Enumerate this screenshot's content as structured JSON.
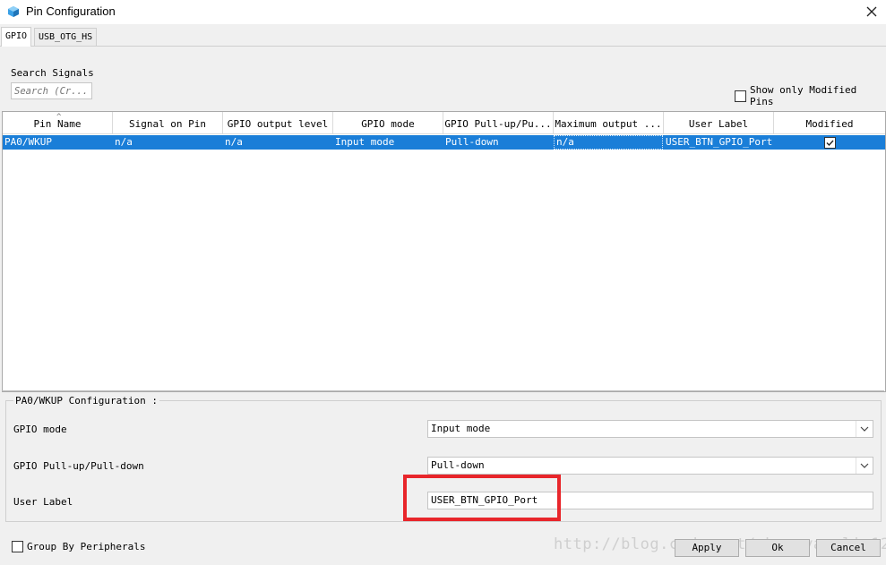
{
  "window": {
    "title": "Pin Configuration",
    "icon": "cube-icon",
    "close_icon": "close-icon"
  },
  "tabs": [
    {
      "label": "GPIO",
      "active": true
    },
    {
      "label": "USB_OTG_HS",
      "active": false
    }
  ],
  "search": {
    "label": "Search Signals",
    "placeholder": "Search (Cr..."
  },
  "show_modified": {
    "label": "Show only Modified Pins",
    "checked": false
  },
  "table": {
    "headers": [
      "Pin Name",
      "Signal on Pin",
      "GPIO output level",
      "GPIO mode",
      "GPIO Pull-up/Pu...",
      "Maximum output ...",
      "User Label",
      "Modified"
    ],
    "rows": [
      {
        "pin_name": "PA0/WKUP",
        "signal_on_pin": "n/a",
        "gpio_output_level": "n/a",
        "gpio_mode": "Input mode",
        "gpio_pull": "Pull-down",
        "max_output": "n/a",
        "user_label": "USER_BTN_GPIO_Port",
        "modified": true
      }
    ]
  },
  "config": {
    "title": "PA0/WKUP Configuration :",
    "gpio_mode_label": "GPIO mode",
    "gpio_mode_value": "Input mode",
    "gpio_pull_label": "GPIO Pull-up/Pull-down",
    "gpio_pull_value": "Pull-down",
    "user_label_label": "User Label",
    "user_label_value": "USER_BTN_GPIO_Port"
  },
  "bottom": {
    "group_by_label": "Group By Peripherals",
    "group_by_checked": false,
    "apply_label": "Apply",
    "ok_label": "Ok",
    "cancel_label": "Cancel"
  },
  "watermark": "http://blog.csdn.net/zhengyangliu123",
  "colors": {
    "selection": "#1a7ed8",
    "highlight_box": "#e8262b",
    "background": "#f0f0f0"
  }
}
